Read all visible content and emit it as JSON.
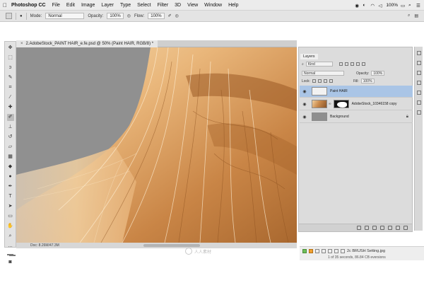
{
  "menubar": {
    "app_name": "Photoshop CC",
    "items": [
      "File",
      "Edit",
      "Image",
      "Layer",
      "Type",
      "Select",
      "Filter",
      "3D",
      "View",
      "Window",
      "Help"
    ],
    "battery": "100%"
  },
  "options_bar": {
    "mode_label": "Mode:",
    "mode_value": "Normal",
    "opacity_label": "Opacity:",
    "opacity_value": "100%",
    "flow_label": "Flow:",
    "flow_value": "100%"
  },
  "document": {
    "tab_title": "2.AdobeStock_PAINT HAIR_e.fe.psd @ 50% (Paint HAIR, RGB/8) *",
    "status_text": "Doc: 8.26M/47.3M"
  },
  "layers_panel": {
    "tab_label": "Layers",
    "kind_label": "Kind",
    "blend_mode": "Normal",
    "opacity_label": "Opacity:",
    "opacity_value": "100%",
    "lock_label": "Lock:",
    "fill_label": "Fill:",
    "fill_value": "100%",
    "layers": [
      {
        "name": "Paint HAIR",
        "selected": true
      },
      {
        "name": "AdobeStock_10346158 copy",
        "selected": false
      },
      {
        "name": "Background",
        "selected": false
      }
    ]
  },
  "downloads": {
    "file_label": "2c BRUSH Setting.jpg",
    "summary": "1 of 35 seconds, 86.84 CB eversions"
  },
  "watermark": {
    "text": "人人素材"
  },
  "colors": {
    "selected_layer": "#aac5e6",
    "canvas_bg": "#909090",
    "hair_light": "#f3d6a6",
    "hair_dark": "#9a5a24"
  }
}
